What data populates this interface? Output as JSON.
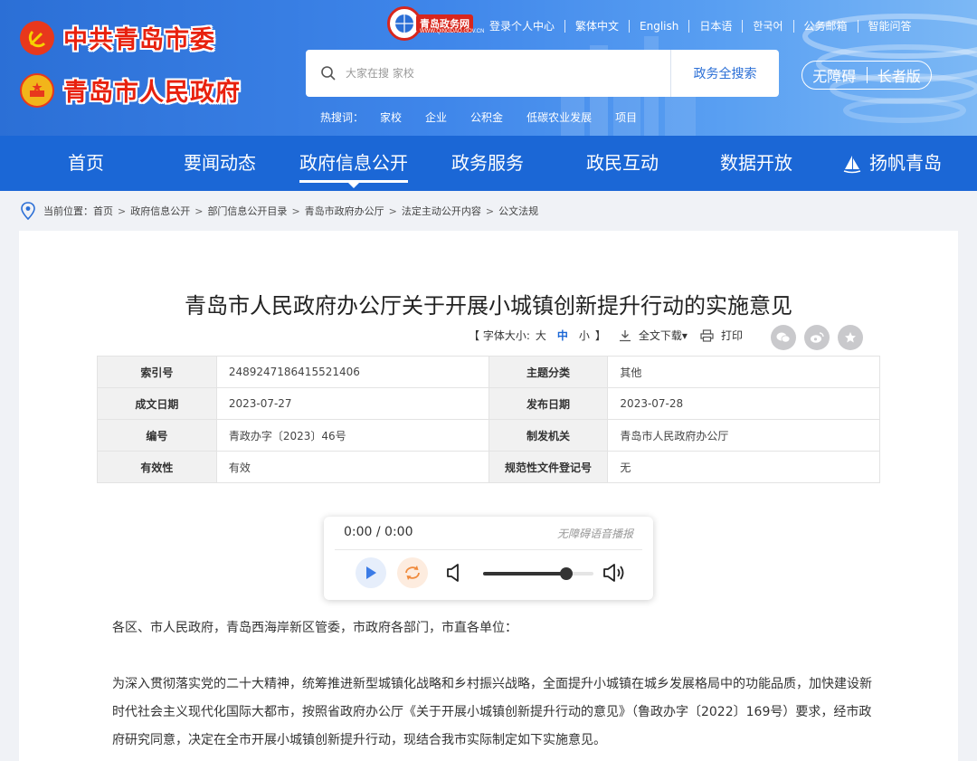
{
  "header": {
    "logo_party": "中共青岛市委",
    "logo_gov": "青岛市人民政府",
    "site_badge": "青岛政务网",
    "site_badge_sub": "WWW.QINGDAO.GOV.CN",
    "top_links": [
      "登录个人中心",
      "繁体中文",
      "English",
      "日本语",
      "한국어",
      "公务邮箱",
      "智能问答"
    ],
    "search": {
      "placeholder": "大家在搜 家校",
      "button": "政务全搜索"
    },
    "hot": {
      "label": "热搜词：",
      "keywords": [
        "家校",
        "企业",
        "公积金",
        "低碳农业发展",
        "项目"
      ]
    },
    "accessibility": {
      "barrier_free": "无障碍",
      "elderly": "长者版"
    }
  },
  "nav": {
    "items": [
      "首页",
      "要闻动态",
      "政府信息公开",
      "政务服务",
      "政民互动",
      "数据开放",
      "扬帆青岛"
    ],
    "active_index": 2
  },
  "breadcrumb": {
    "label": "当前位置：",
    "items": [
      "首页",
      "政府信息公开",
      "部门信息公开目录",
      "青岛市政府办公厅",
      "法定主动公开内容",
      "公文法规"
    ]
  },
  "article": {
    "title": "青岛市人民政府办公厅关于开展小城镇创新提升行动的实施意见",
    "tools": {
      "font_label": "【 字体大小:",
      "font_large": "大",
      "font_medium": "中",
      "font_small": "小",
      "font_close": "】",
      "download": "全文下载▾",
      "print": "打印"
    },
    "meta": [
      {
        "k1": "索引号",
        "v1": "2489247186415521406",
        "k2": "主题分类",
        "v2": "其他"
      },
      {
        "k1": "成文日期",
        "v1": "2023-07-27",
        "k2": "发布日期",
        "v2": "2023-07-28"
      },
      {
        "k1": "编号",
        "v1": "青政办字〔2023〕46号",
        "k2": "制发机关",
        "v2": "青岛市人民政府办公厅"
      },
      {
        "k1": "有效性",
        "v1": "有效",
        "k2": "规范性文件登记号",
        "v2": "无"
      }
    ],
    "player": {
      "time": "0:00 / 0:00",
      "label": "无障碍语音播报",
      "volume": 0.75
    },
    "paragraphs": [
      "各区、市人民政府，青岛西海岸新区管委，市政府各部门，市直各单位：",
      "为深入贯彻落实党的二十大精神，统筹推进新型城镇化战略和乡村振兴战略，全面提升小城镇在城乡发展格局中的功能品质，加快建设新时代社会主义现代化国际大都市，按照省政府办公厅《关于开展小城镇创新提升行动的意见》（鲁政办字〔2022〕169号）要求，经市政府研究同意，决定在全市开展小城镇创新提升行动，现结合我市实际制定如下实施意见。"
    ]
  },
  "colors": {
    "nav_bg": "#1b67d6",
    "header_blue": "#3f86ea",
    "logo_red": "#e8210e"
  }
}
